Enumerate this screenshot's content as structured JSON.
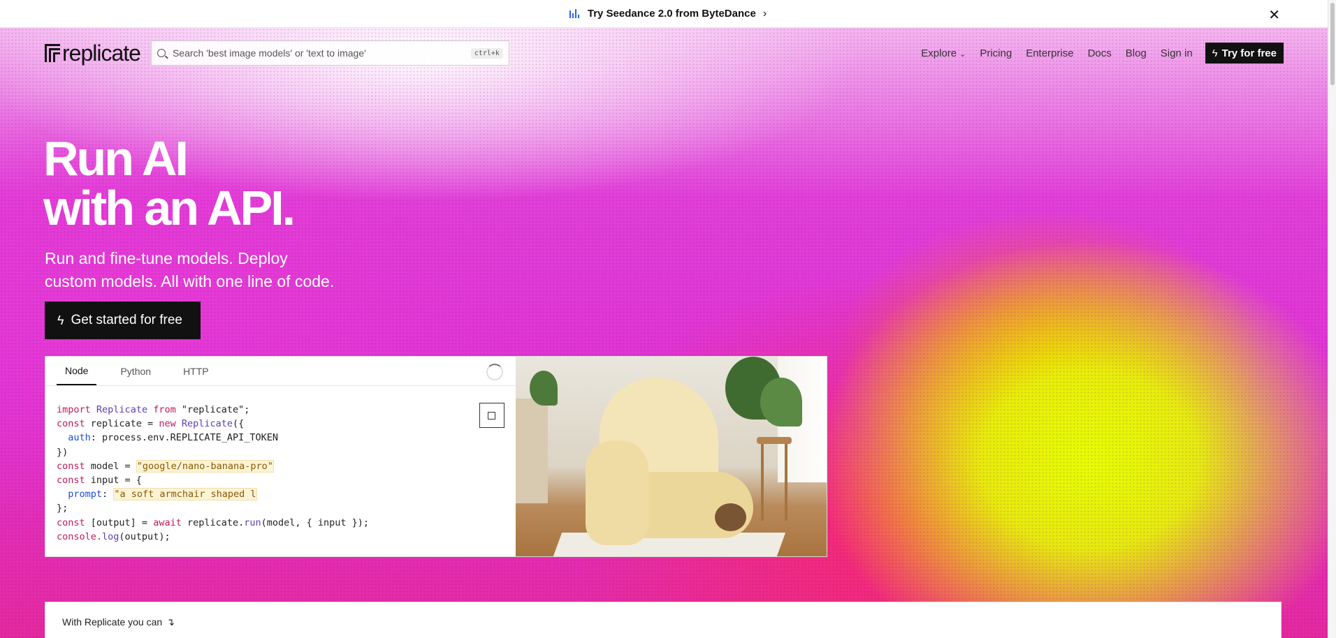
{
  "announcement": {
    "text": "Try Seedance 2.0 from ByteDance",
    "chevron": "›",
    "close": "✕"
  },
  "nav": {
    "logo": "replicate",
    "search_placeholder": "Search 'best image models' or 'text to image'",
    "search_shortcut": "ctrl+k",
    "links": [
      "Explore",
      "Pricing",
      "Enterprise",
      "Docs",
      "Blog",
      "Sign in"
    ],
    "cta": "Try for free"
  },
  "hero": {
    "headline_line1": "Run AI",
    "headline_line2": "with an API.",
    "sub_line1": "Run and fine-tune models. Deploy",
    "sub_line2": "custom models. All with one line of code.",
    "cta": "Get started for free"
  },
  "code_card": {
    "tabs": [
      "Node",
      "Python",
      "HTTP"
    ],
    "active_tab": "Node",
    "code": {
      "import_kw": "import",
      "import_cls": "Replicate",
      "from_kw": "from",
      "import_src": "\"replicate\";",
      "const1": "const",
      "replicate_var": " replicate = ",
      "new_kw": "new",
      "new_cls": "Replicate",
      "new_open": "({",
      "auth_key": "auth",
      "auth_val": ": process.env.REPLICATE_API_TOKEN",
      "close_obj": "})",
      "const2": "const",
      "model_var": " model = ",
      "model_val": "\"google/nano-banana-pro\"",
      "const3": "const",
      "input_var": " input = {",
      "prompt_key": "prompt",
      "prompt_val": "\"a soft armchair shaped l",
      "close_input": "};",
      "const4": "const",
      "output_var": " [output] = ",
      "await_kw": "await",
      "run_pre": " replicate.",
      "run_fn": "run",
      "run_args": "(model, { input });",
      "console": "console.",
      "log_fn": "log",
      "log_args": "(output);"
    }
  },
  "bottom": {
    "text": "With Replicate you can",
    "arrow": "↴"
  },
  "colors": {
    "accent_dark": "#111111",
    "gradient_pink": "#e13fd8",
    "gradient_yellow": "#e6ff00"
  }
}
